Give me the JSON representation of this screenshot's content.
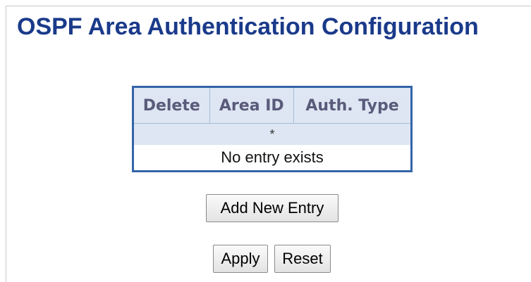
{
  "page": {
    "title": "OSPF Area Authentication Configuration"
  },
  "table": {
    "headers": [
      "Delete",
      "Area ID",
      "Auth. Type"
    ],
    "filter_marker": "*",
    "empty_message": "No entry exists"
  },
  "buttons": {
    "add_new_entry": "Add New Entry",
    "apply": "Apply",
    "reset": "Reset"
  },
  "colors": {
    "title": "#1a3a8a",
    "table_border": "#3464a8",
    "header_background": "#dde6f2",
    "header_text": "#5a5a7a"
  }
}
